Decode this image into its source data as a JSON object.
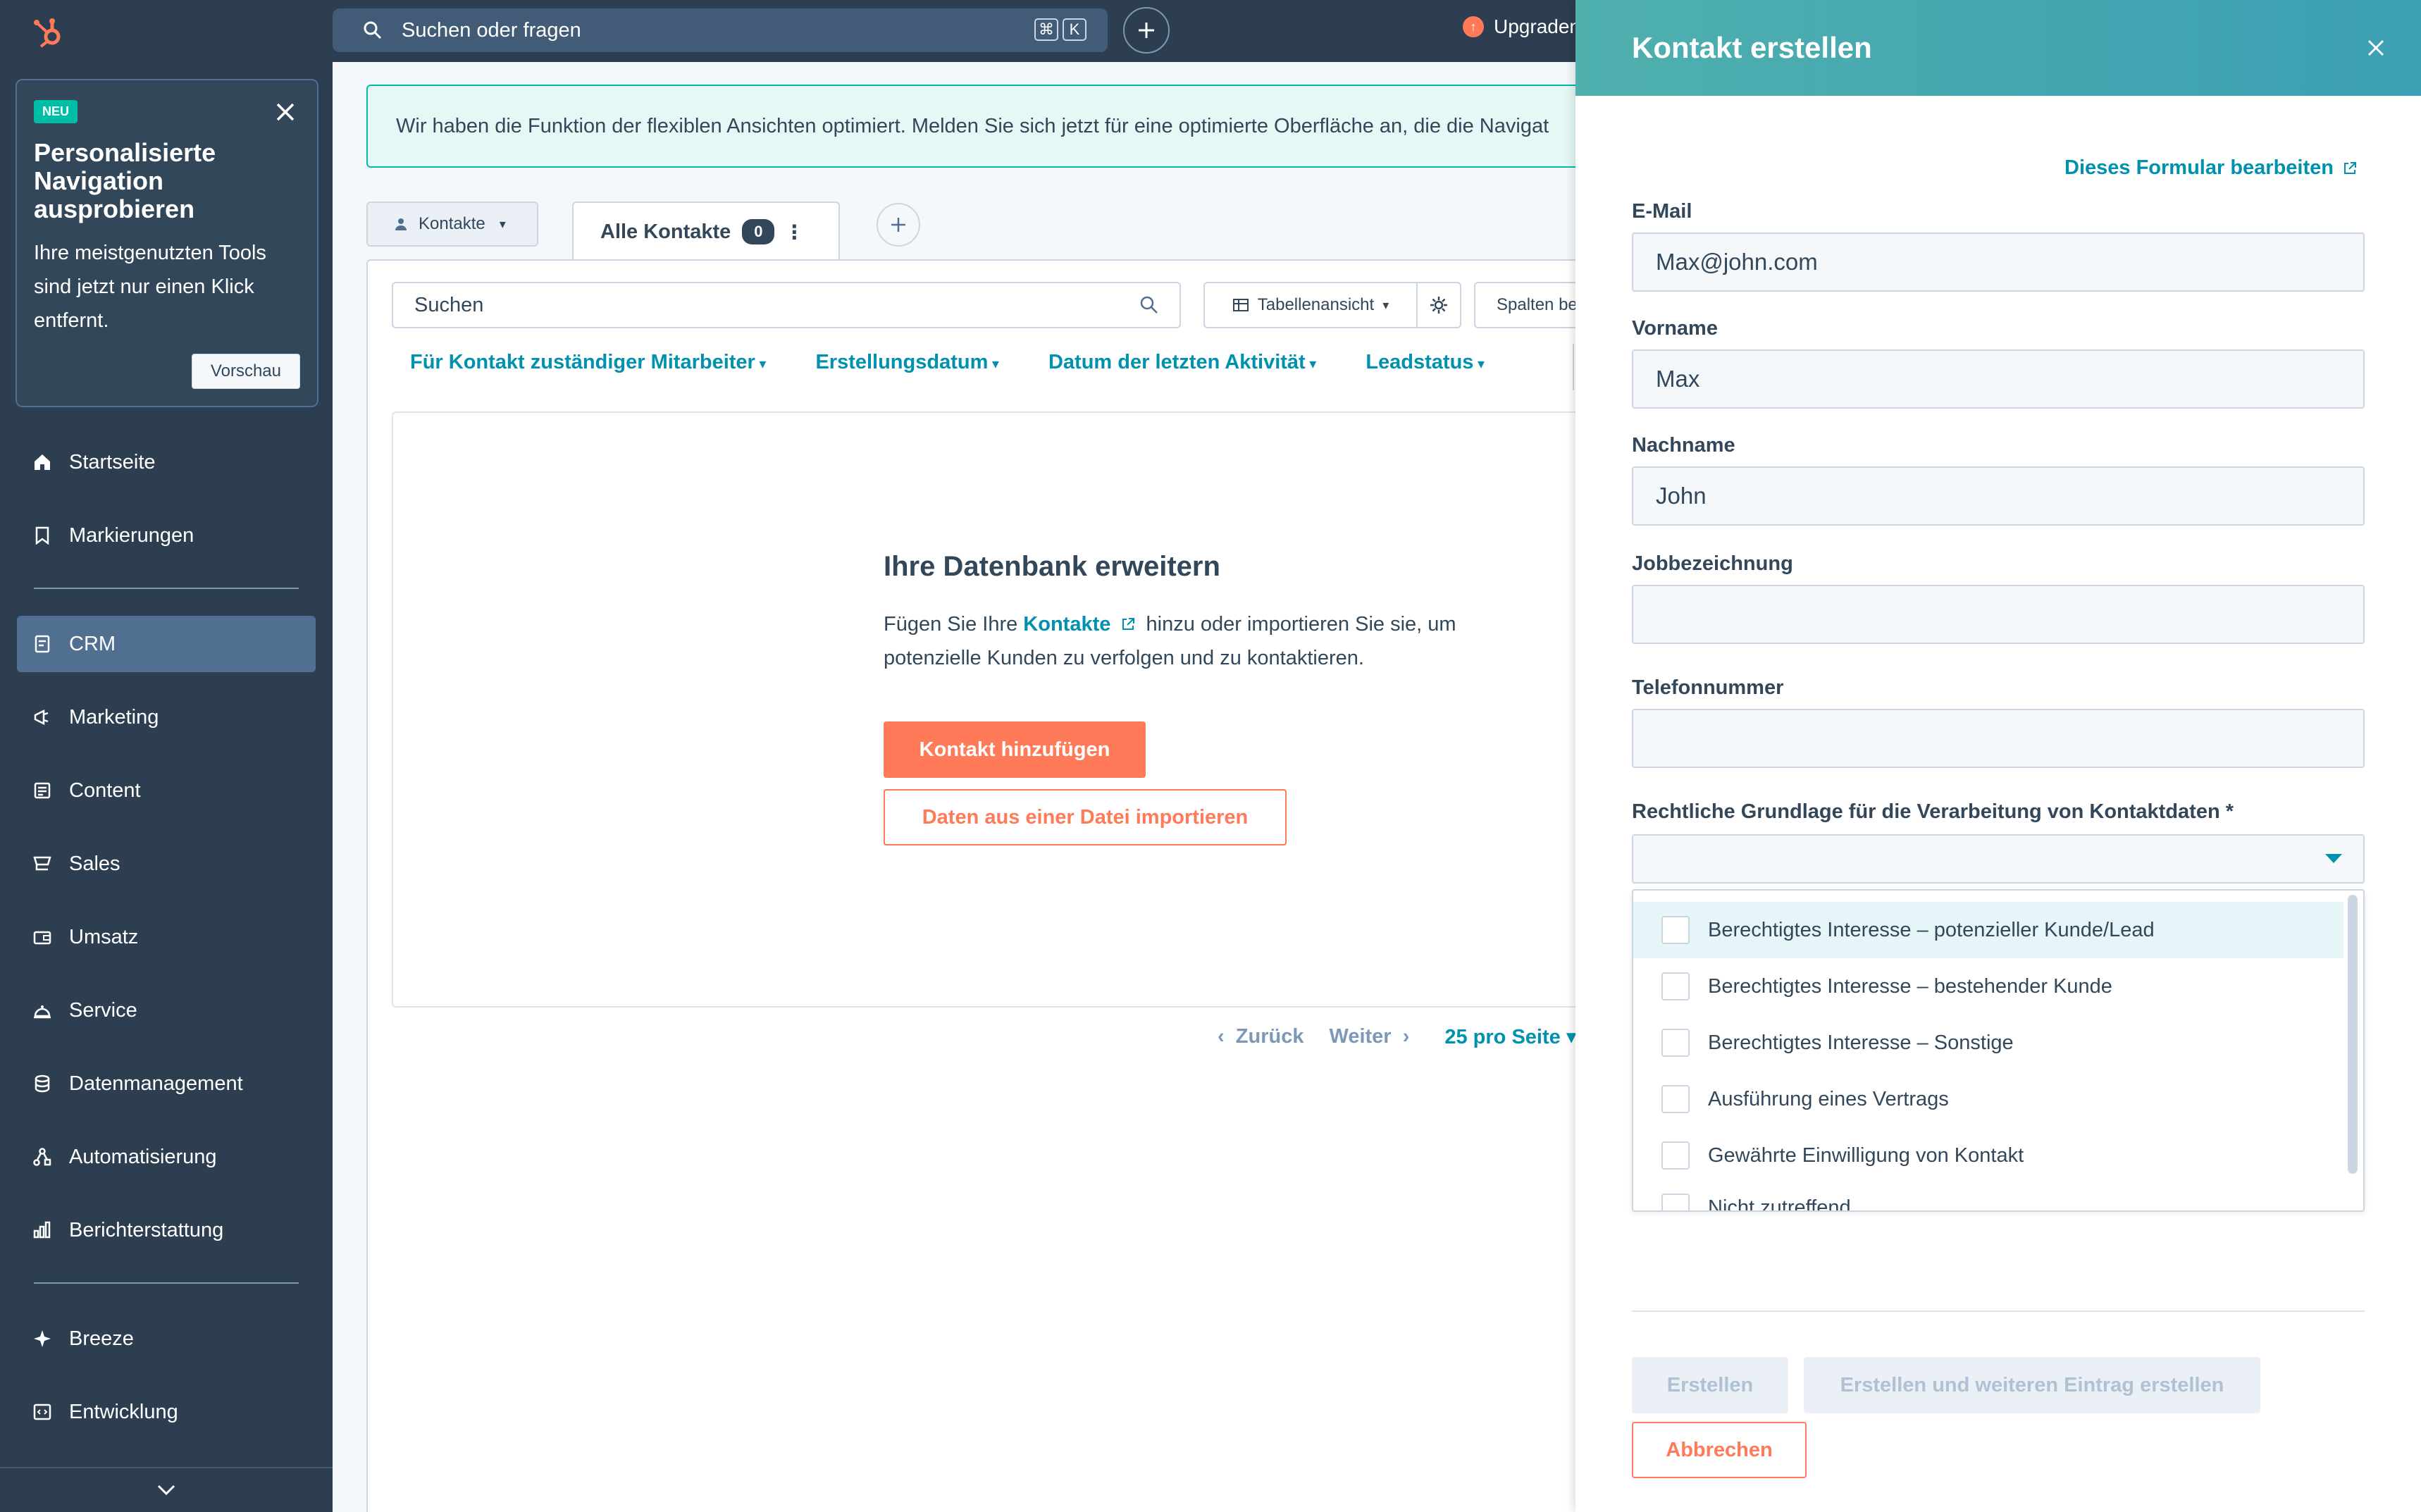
{
  "sidebar": {
    "promo": {
      "badge": "NEU",
      "title": "Personalisierte Navigation ausprobieren",
      "text": "Ihre meistgenutzten Tools sind jetzt nur einen Klick entfernt.",
      "preview_label": "Vorschau"
    },
    "items": [
      {
        "label": "Startseite",
        "icon": "home-icon"
      },
      {
        "label": "Markierungen",
        "icon": "bookmark-icon"
      },
      {
        "label": "CRM",
        "icon": "crm-icon",
        "active": true
      },
      {
        "label": "Marketing",
        "icon": "megaphone-icon"
      },
      {
        "label": "Content",
        "icon": "content-icon"
      },
      {
        "label": "Sales",
        "icon": "sales-icon"
      },
      {
        "label": "Umsatz",
        "icon": "wallet-icon"
      },
      {
        "label": "Service",
        "icon": "service-icon"
      },
      {
        "label": "Datenmanagement",
        "icon": "database-icon"
      },
      {
        "label": "Automatisierung",
        "icon": "workflow-icon"
      },
      {
        "label": "Berichterstattung",
        "icon": "chart-icon"
      },
      {
        "label": "Breeze",
        "icon": "sparkle-icon"
      },
      {
        "label": "Entwicklung",
        "icon": "code-icon"
      }
    ]
  },
  "topbar": {
    "search_placeholder": "Suchen oder fragen",
    "shortcut_cmd": "⌘",
    "shortcut_key": "K",
    "upgrade_label": "Upgraden"
  },
  "main": {
    "notice": "Wir haben die Funktion der flexiblen Ansichten optimiert. Melden Sie sich jetzt für eine optimierte Oberfläche an, die die Navigat",
    "object_select": "Kontakte",
    "tab": {
      "label": "Alle Kontakte",
      "count": "0"
    },
    "search_placeholder": "Suchen",
    "view_label": "Tabellenansicht",
    "columns_label": "Spalten be",
    "filters": [
      "Für Kontakt zuständiger Mitarbeiter",
      "Erstellungsdatum",
      "Datum der letzten Aktivität",
      "Leadstatus"
    ],
    "empty": {
      "title": "Ihre Datenbank erweitern",
      "text_before": "Fügen Sie Ihre ",
      "link": "Kontakte",
      "text_after": " hinzu oder importieren Sie sie, um potenzielle Kunden zu verfolgen und zu kontaktieren.",
      "add_button": "Kontakt hinzufügen",
      "import_button": "Daten aus einer Datei importieren"
    },
    "pagination": {
      "prev": "Zurück",
      "next": "Weiter",
      "per_page": "25 pro Seite"
    }
  },
  "drawer": {
    "title": "Kontakt erstellen",
    "edit_form_link": "Dieses Formular bearbeiten",
    "fields": {
      "email": {
        "label": "E-Mail",
        "value": "Max@john.com"
      },
      "firstname": {
        "label": "Vorname",
        "value": "Max"
      },
      "lastname": {
        "label": "Nachname",
        "value": "John"
      },
      "jobtitle": {
        "label": "Jobbezeichnung",
        "value": ""
      },
      "phone": {
        "label": "Telefonnummer",
        "value": ""
      },
      "legal_basis": {
        "label": "Rechtliche Grundlage für die Verarbeitung von Kontaktdaten *"
      }
    },
    "legal_options": [
      "Berechtigtes Interesse – potenzieller Kunde/Lead",
      "Berechtigtes Interesse – bestehender Kunde",
      "Berechtigtes Interesse – Sonstige",
      "Ausführung eines Vertrags",
      "Gewährte Einwilligung von Kontakt",
      "Nicht zutreffend"
    ],
    "buttons": {
      "create": "Erstellen",
      "create_another": "Erstellen und weiteren Eintrag erstellen",
      "cancel": "Abbrechen"
    }
  },
  "colors": {
    "sidebar_bg": "#2d3e50",
    "accent_teal": "#00bda5",
    "link": "#0091ae",
    "primary_orange": "#ff7a59"
  }
}
